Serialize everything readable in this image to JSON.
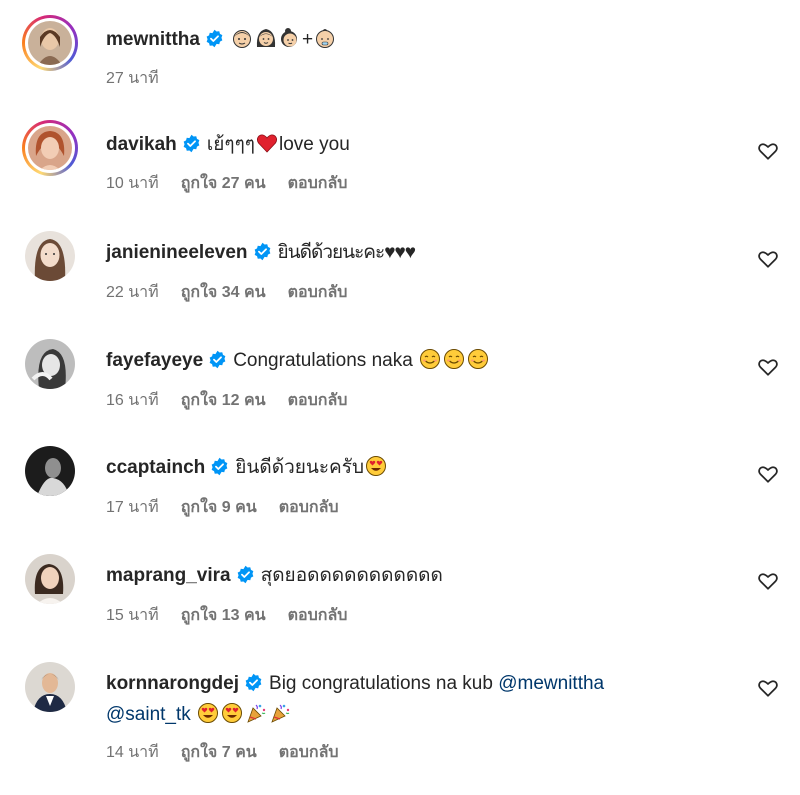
{
  "comments": [
    {
      "username": "mewnittha",
      "text": "+",
      "time": "27 นาที",
      "emojis_before": [
        "man-face-emoji",
        "woman-face-emoji",
        "woman-with-bun-emoji"
      ],
      "emojis_after": [
        "baby-emoji"
      ],
      "has_ring": true,
      "verified": true
    },
    {
      "username": "davikah",
      "text": "เย้ๆๆๆ",
      "text_after": "love you",
      "time": "10 นาที",
      "likes": "ถูกใจ 27 คน",
      "reply": "ตอบกลับ",
      "emojis_mid": [
        "red-heart-emoji"
      ],
      "has_ring": true,
      "verified": true
    },
    {
      "username": "janienineeleven",
      "text": "ยินดีด้วยนะคะ♥♥♥",
      "time": "22 นาที",
      "likes": "ถูกใจ 34 คน",
      "reply": "ตอบกลับ",
      "verified": true
    },
    {
      "username": "fayefayeye",
      "text": "Congratulations naka",
      "time": "16 นาที",
      "likes": "ถูกใจ 12 คน",
      "reply": "ตอบกลับ",
      "emojis_after": [
        "smiling-face-emoji",
        "smiling-face-emoji",
        "smiling-face-emoji"
      ],
      "verified": true
    },
    {
      "username": "ccaptainch",
      "text": "ยินดีด้วยนะครับ",
      "time": "17 นาที",
      "likes": "ถูกใจ 9 คน",
      "reply": "ตอบกลับ",
      "emojis_after": [
        "heart-eyes-emoji"
      ],
      "verified": true
    },
    {
      "username": "maprang_vira",
      "text": "สุดยอดดดดดดดดดดด",
      "time": "15 นาที",
      "likes": "ถูกใจ 13 คน",
      "reply": "ตอบกลับ",
      "verified": true
    },
    {
      "username": "kornnarongdej",
      "text": "Big congratulations na kub",
      "mention1": "@mewnittha",
      "mention2": "@saint_tk",
      "time": "14 นาที",
      "likes": "ถูกใจ 7 คน",
      "reply": "ตอบกลับ",
      "emojis_after": [
        "heart-eyes-emoji",
        "heart-eyes-emoji",
        "party-popper-emoji",
        "party-popper-emoji"
      ],
      "verified": true
    }
  ],
  "colors": {
    "verified_blue": "#0095f6",
    "meta_gray": "#737373",
    "mention_blue": "#00376b",
    "text": "#262626"
  }
}
